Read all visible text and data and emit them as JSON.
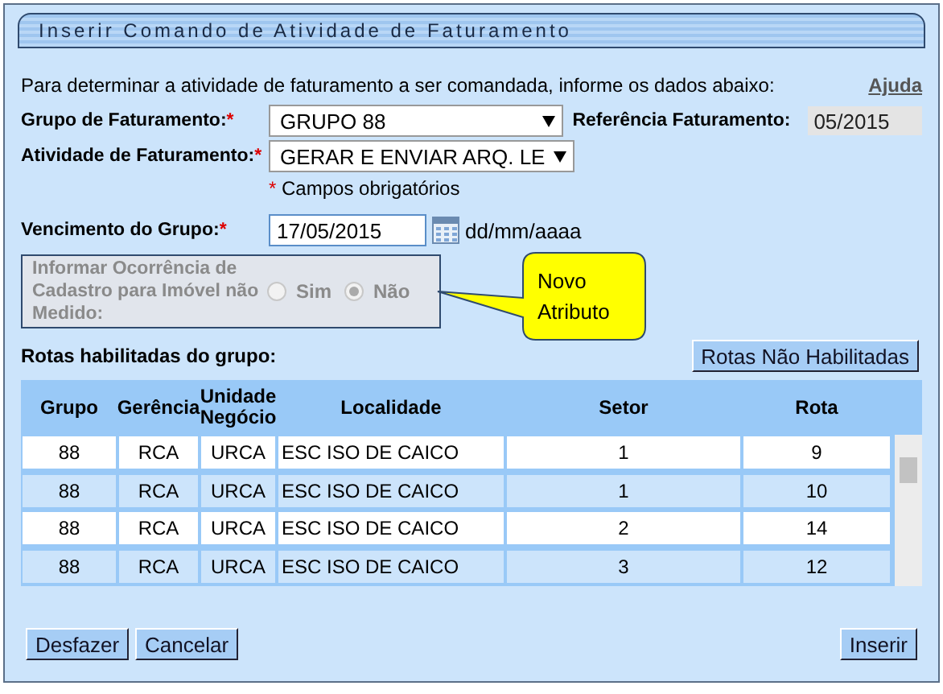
{
  "window": {
    "title": "Inserir Comando de Atividade de Faturamento"
  },
  "intro": "Para determinar a atividade de faturamento a ser comandada, informe os dados abaixo:",
  "help_link": "Ajuda",
  "grupo": {
    "label": "Grupo de Faturamento:",
    "required_mark": "*",
    "value": "GRUPO 88"
  },
  "referencia": {
    "label": "Referência Faturamento:",
    "value": "05/2015"
  },
  "atividade": {
    "label": "Atividade de Faturamento:",
    "required_mark": "*",
    "value": "GERAR E ENVIAR ARQ. LE"
  },
  "required_note": {
    "mark": "*",
    "text": "Campos obrigatórios"
  },
  "vencimento": {
    "label": "Vencimento do Grupo:",
    "required_mark": "*",
    "value": "17/05/2015",
    "format": "dd/mm/aaaa"
  },
  "ocorrencia": {
    "label": "Informar Ocorrência de Cadastro para  Imóvel não Medido:",
    "disabled": true,
    "options": [
      {
        "label": "Sim",
        "selected": false
      },
      {
        "label": "Não",
        "selected": true
      }
    ]
  },
  "callout": "Novo Atributo",
  "rotas_label": "Rotas habilitadas do grupo:",
  "rotas_button": "Rotas Não Habilitadas",
  "table": {
    "columns": [
      "Grupo",
      "Gerência",
      "Unidade Negócio",
      "Localidade",
      "Setor",
      "Rota"
    ],
    "rows": [
      {
        "cells": [
          "88",
          "RCA",
          "URCA",
          "ESC ISO DE CAICO",
          "1",
          "9"
        ]
      },
      {
        "cells": [
          "88",
          "RCA",
          "URCA",
          "ESC ISO DE CAICO",
          "1",
          "10"
        ]
      },
      {
        "cells": [
          "88",
          "RCA",
          "URCA",
          "ESC ISO DE CAICO",
          "2",
          "14"
        ]
      },
      {
        "cells": [
          "88",
          "RCA",
          "URCA",
          "ESC ISO DE CAICO",
          "3",
          "12"
        ]
      }
    ]
  },
  "buttons": {
    "left": [
      "Desfazer",
      "Cancelar"
    ],
    "right": [
      "Inserir"
    ]
  }
}
